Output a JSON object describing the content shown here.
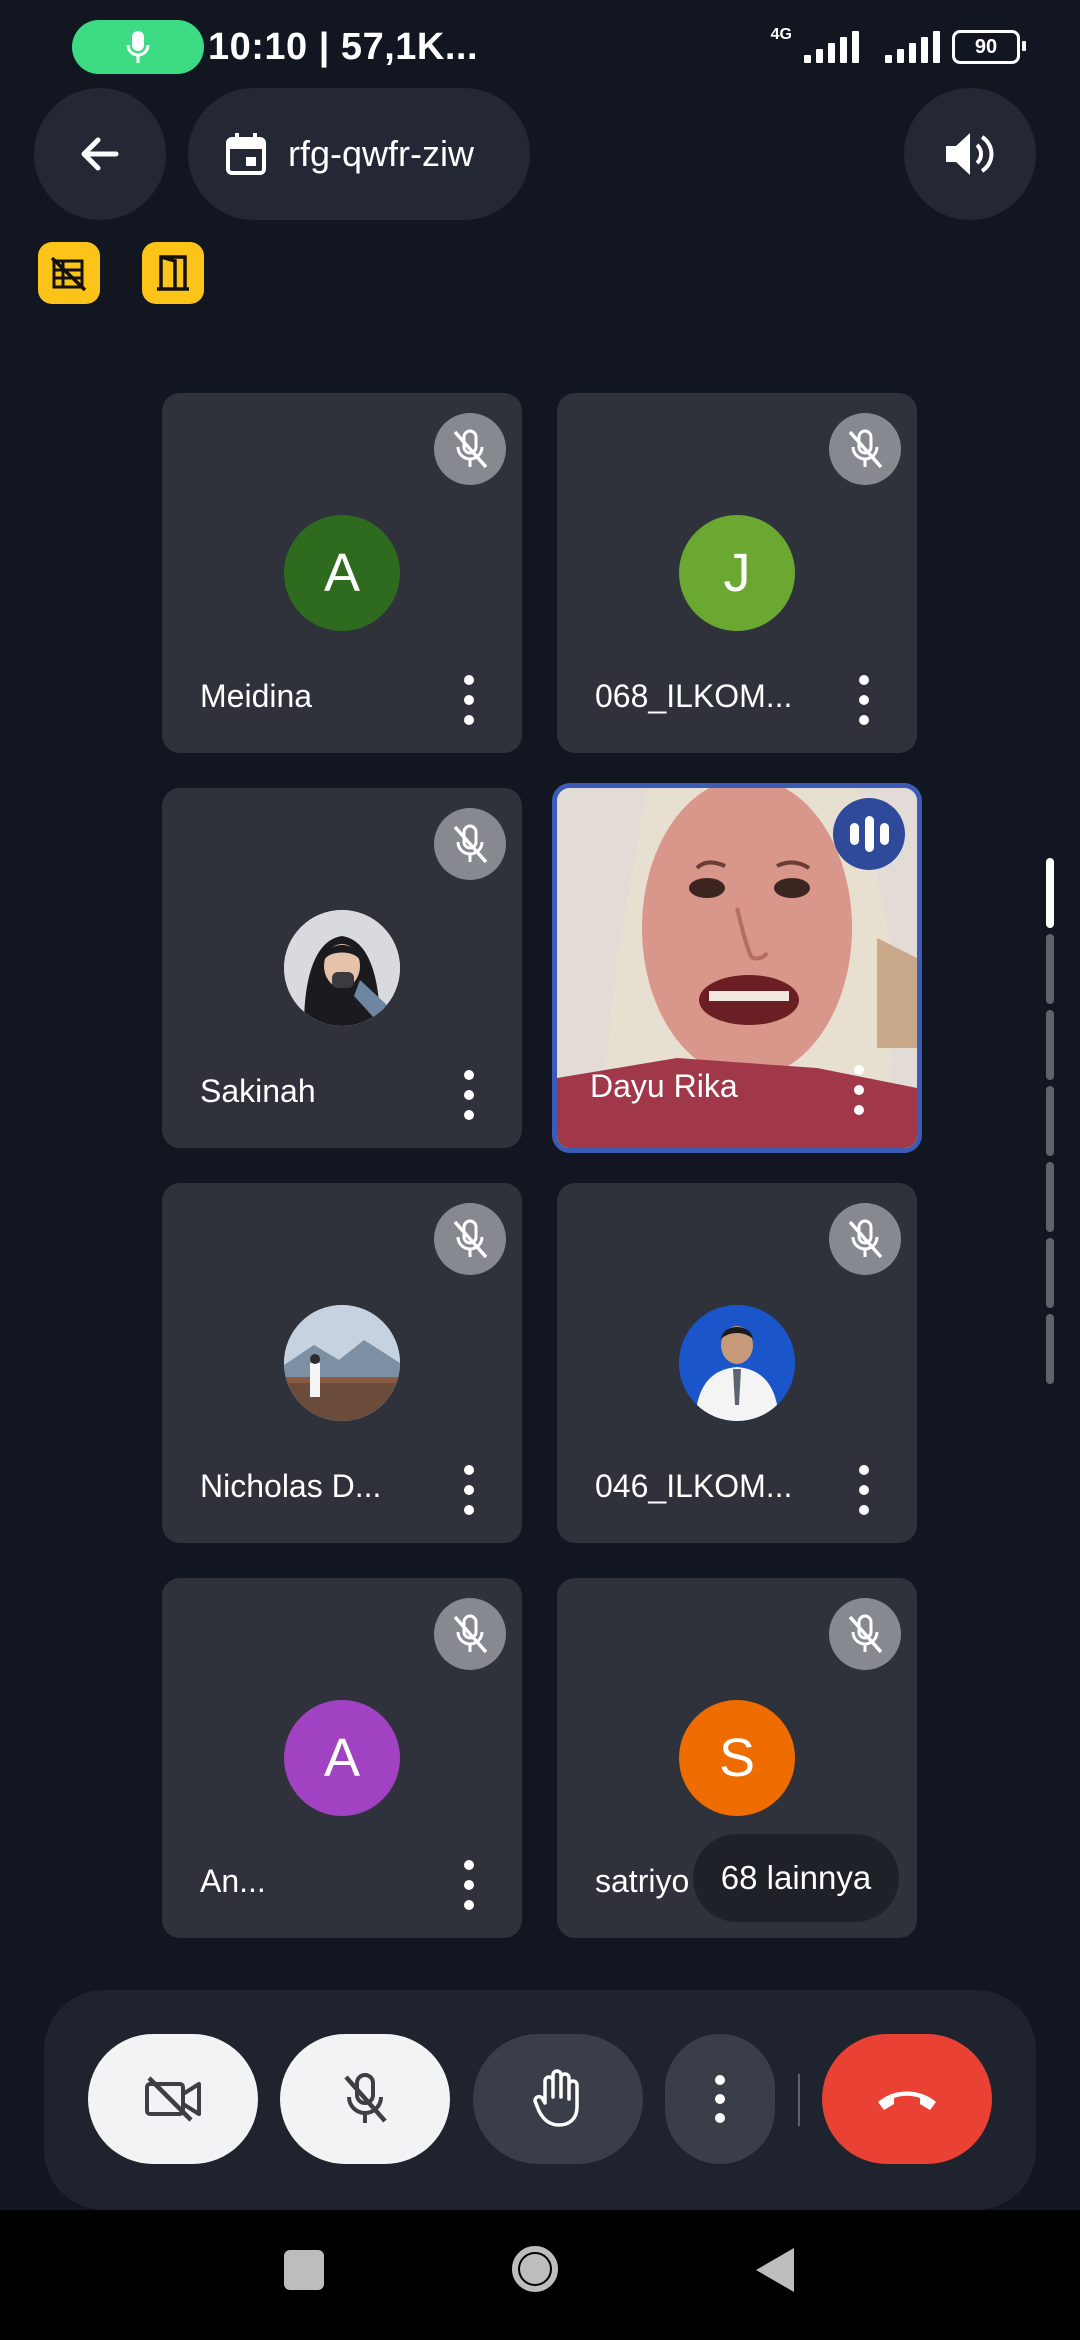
{
  "status_bar": {
    "text": "10:10 | 57,1K...",
    "network": "4G",
    "battery": "90"
  },
  "header": {
    "back_icon": "arrow-back-icon",
    "meeting_code": "rfg-qwfr-ziw",
    "speaker_icon": "volume-icon"
  },
  "badges": [
    {
      "icon": "grid-off-icon",
      "color": "#fcc419"
    },
    {
      "icon": "door-icon",
      "color": "#fcc419"
    }
  ],
  "participants": [
    {
      "name": "Meidina",
      "initial": "A",
      "avatar_color": "#2e6b1f",
      "muted": true
    },
    {
      "name": "068_ILKOM...",
      "initial": "J",
      "avatar_color": "#6aa832",
      "muted": true
    },
    {
      "name": "Sakinah",
      "initial": "",
      "avatar_color": "#c9ccd1",
      "muted": true,
      "photo": true
    },
    {
      "name": "Dayu Rika",
      "initial": "",
      "avatar_color": "#d9cfc9",
      "muted": false,
      "video": true,
      "speaking": true
    },
    {
      "name": "Nicholas D...",
      "initial": "",
      "avatar_color": "#a9b7c6",
      "muted": true,
      "photo": true
    },
    {
      "name": "046_ILKOM...",
      "initial": "",
      "avatar_color": "#1a56c9",
      "muted": true,
      "photo": true
    },
    {
      "name": "An...",
      "initial": "A",
      "avatar_color": "#a142c3",
      "muted": true
    },
    {
      "name": "satriyo",
      "initial": "S",
      "avatar_color": "#ef6c00",
      "muted": true
    }
  ],
  "more_participants": "68 lainnya",
  "controls": {
    "camera_icon": "camera-off-icon",
    "mic_icon": "mic-off-icon",
    "hand_icon": "raise-hand-icon",
    "more_icon": "more-vert-icon",
    "end_icon": "end-call-icon",
    "end_color": "#e94235"
  },
  "colors": {
    "background": "#121620",
    "tile": "#2f323b",
    "active_border": "#3b5bb5",
    "mic_pill": "#3ddc84"
  }
}
